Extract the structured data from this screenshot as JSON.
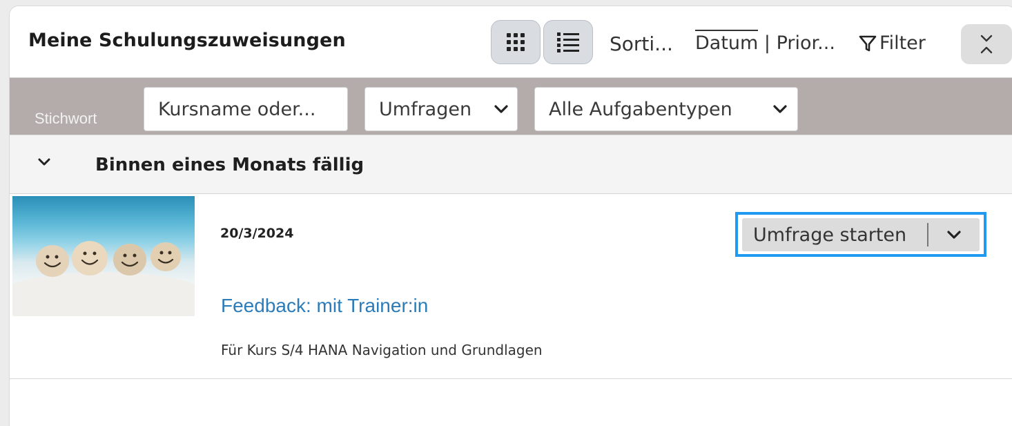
{
  "header": {
    "title": "Meine Schulungszuweisungen",
    "sort_label": "Sorti...",
    "sort_active": "Datum",
    "sort_separator": " | ",
    "sort_other": "Prior...",
    "filter_label": "Filter"
  },
  "filterbar": {
    "keyword_label": "Stichwort",
    "keyword_placeholder": "Kursname oder...",
    "survey_select": "Umfragen",
    "type_select": "Alle Aufgabentypen"
  },
  "group": {
    "title": "Binnen eines Monats fällig"
  },
  "item": {
    "due_date": "20/3/2024",
    "title": "Feedback: mit Trainer:in",
    "subtitle": "Für Kurs S/4 HANA Navigation und Grundlagen",
    "action_label": "Umfrage starten"
  },
  "icons": {
    "grid_view": "grid-view-icon",
    "list_view": "list-view-icon",
    "filter": "filter-funnel-icon",
    "collapse": "collapse-expand-icon",
    "chevron": "chevron-down-icon"
  },
  "colors": {
    "accent_link": "#2b7cb8",
    "focus_outline": "#1e9bf0",
    "filterbar_bg": "#b3acaa"
  }
}
